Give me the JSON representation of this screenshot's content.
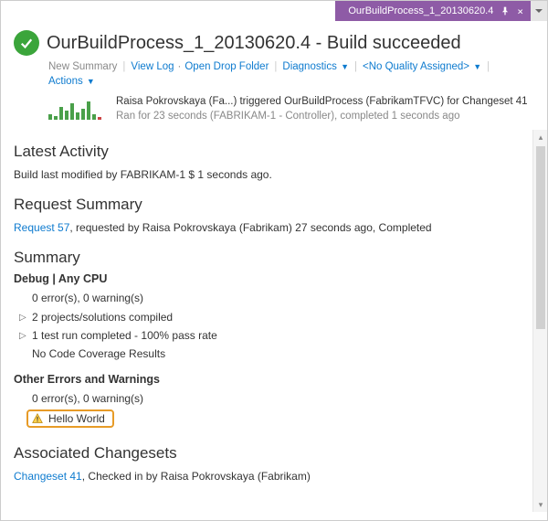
{
  "tab": {
    "title": "OurBuildProcess_1_20130620.4"
  },
  "header": {
    "title": "OurBuildProcess_1_20130620.4 - Build succeeded",
    "links": {
      "new_summary": "New Summary",
      "view_log": "View Log",
      "open_drop": "Open Drop Folder",
      "diagnostics": "Diagnostics",
      "quality": "<No Quality Assigned>",
      "actions": "Actions"
    },
    "trigger": {
      "line1": "Raisa Pokrovskaya (Fa...) triggered OurBuildProcess (FabrikamTFVC) for Changeset 41",
      "line2": "Ran for 23 seconds (FABRIKAM-1 - Controller), completed 1 seconds ago"
    }
  },
  "sections": {
    "latest_activity": {
      "heading": "Latest Activity",
      "text": "Build last modified by FABRIKAM-1 $ 1 seconds ago."
    },
    "request_summary": {
      "heading": "Request Summary",
      "link": "Request 57",
      "rest": ", requested by Raisa Pokrovskaya (Fabrikam) 27 seconds ago, Completed"
    },
    "summary": {
      "heading": "Summary",
      "config": "Debug  |  Any CPU",
      "items": {
        "errs": "0 error(s), 0 warning(s)",
        "compiled": "2 projects/solutions compiled",
        "tests": "1 test run completed - 100% pass rate",
        "coverage": "No Code Coverage Results"
      },
      "other_heading": "Other Errors and Warnings",
      "other_errs": "0 error(s), 0 warning(s)",
      "hello": "Hello World"
    },
    "changesets": {
      "heading": "Associated Changesets",
      "link": "Changeset 41",
      "rest": ", Checked in by Raisa Pokrovskaya (Fabrikam)"
    }
  }
}
